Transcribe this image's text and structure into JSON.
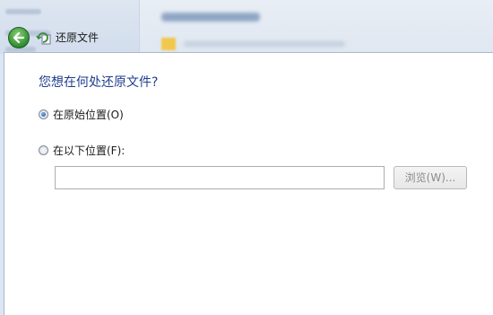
{
  "header": {
    "title": "还原文件"
  },
  "dialog": {
    "heading": "您想在何处还原文件?",
    "options": [
      {
        "label": "在原始位置(O)",
        "checked": true
      },
      {
        "label": "在以下位置(F):",
        "checked": false
      }
    ],
    "path_input": {
      "value": "",
      "placeholder": ""
    },
    "browse_label": "浏览(W)..."
  },
  "colors": {
    "heading": "#1e3f8f",
    "back_button": "#2e8c2f",
    "disabled_text": "#8c8c8c"
  },
  "icons": {
    "back": "back-arrow-icon",
    "restore": "restore-files-icon"
  }
}
